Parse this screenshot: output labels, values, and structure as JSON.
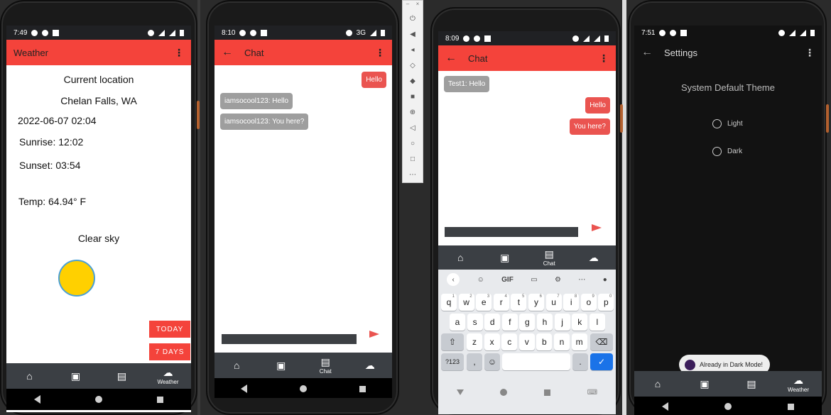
{
  "weather": {
    "status_time": "7:49",
    "title": "Weather",
    "location_heading": "Current location",
    "location": "Chelan Falls, WA",
    "datetime": "2022-06-07 02:04",
    "sunrise": "Sunrise: 12:02",
    "sunset": "Sunset: 03:54",
    "temp": "Temp: 64.94° F",
    "condition": "Clear sky",
    "today_button": "TODAY",
    "seven_days_button": "7 DAYS",
    "nav": {
      "weather": "Weather"
    }
  },
  "chat1": {
    "status_time": "8:10",
    "network": "3G",
    "title": "Chat",
    "messages": [
      "Hello",
      "iamsocool123: Hello",
      "iamsocool123: You here?"
    ],
    "nav": {
      "chat": "Chat"
    }
  },
  "chat2": {
    "status_time": "8:09",
    "title": "Chat",
    "messages": [
      "Test1: Hello",
      "Hello",
      "You here?"
    ],
    "nav": {
      "chat": "Chat"
    },
    "keyboard": {
      "gif": "GIF",
      "row1": [
        "q",
        "w",
        "e",
        "r",
        "t",
        "y",
        "u",
        "i",
        "o",
        "p"
      ],
      "row1_hints": [
        "1",
        "2",
        "3",
        "4",
        "5",
        "6",
        "7",
        "8",
        "9",
        "0"
      ],
      "row2": [
        "a",
        "s",
        "d",
        "f",
        "g",
        "h",
        "j",
        "k",
        "l"
      ],
      "row3": [
        "z",
        "x",
        "c",
        "v",
        "b",
        "n",
        "m"
      ],
      "symbols_key": "?123",
      "comma": ",",
      "period": "."
    }
  },
  "settings": {
    "status_time": "7:51",
    "title": "Settings",
    "heading": "System Default Theme",
    "option_light": "Light",
    "option_dark": "Dark",
    "toast": "Already in Dark Mode!",
    "nav": {
      "weather": "Weather"
    }
  },
  "colors": {
    "accent": "#f4433b",
    "bubble_mine": "#ea5450",
    "bubble_theirs": "#9e9e9e",
    "navbar": "#3b3f44"
  }
}
